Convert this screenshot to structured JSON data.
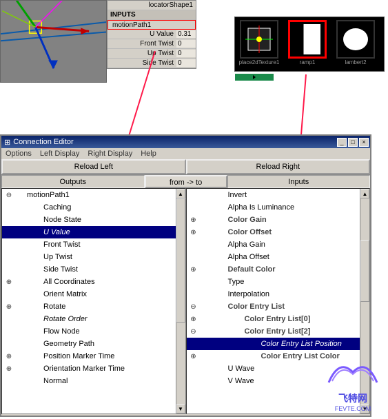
{
  "attr_panel": {
    "shape": "locatorShape1",
    "inputs_header": "INPUTS",
    "node": "motionPath1",
    "rows": [
      {
        "label": "U Value",
        "value": "0.31"
      },
      {
        "label": "Front Twist",
        "value": "0"
      },
      {
        "label": "Up Twist",
        "value": "0"
      },
      {
        "label": "Side Twist",
        "value": "0"
      }
    ]
  },
  "hypershade": {
    "nodes": [
      {
        "name": "place2dTexture1",
        "selected": false,
        "kind": "place2d"
      },
      {
        "name": "ramp1",
        "selected": true,
        "kind": "ramp"
      },
      {
        "name": "lambert2",
        "selected": false,
        "kind": "lambert"
      }
    ]
  },
  "conn_editor": {
    "title": "Connection Editor",
    "menus": [
      "Options",
      "Left Display",
      "Right Display",
      "Help"
    ],
    "reload_left": "Reload Left",
    "reload_right": "Reload Right",
    "outputs_label": "Outputs",
    "fromto_label": "from -> to",
    "inputs_label": "Inputs",
    "left_tree": [
      {
        "exp": "⊖",
        "indent": 0,
        "text": "motionPath1",
        "italic": false,
        "bold": false,
        "sel": false
      },
      {
        "exp": "",
        "indent": 1,
        "text": "Caching",
        "italic": false,
        "bold": false,
        "sel": false
      },
      {
        "exp": "",
        "indent": 1,
        "text": "Node State",
        "italic": false,
        "bold": false,
        "sel": false
      },
      {
        "exp": "",
        "indent": 1,
        "text": "U Value",
        "italic": true,
        "bold": false,
        "sel": true
      },
      {
        "exp": "",
        "indent": 1,
        "text": "Front Twist",
        "italic": false,
        "bold": false,
        "sel": false
      },
      {
        "exp": "",
        "indent": 1,
        "text": "Up Twist",
        "italic": false,
        "bold": false,
        "sel": false
      },
      {
        "exp": "",
        "indent": 1,
        "text": "Side Twist",
        "italic": false,
        "bold": false,
        "sel": false
      },
      {
        "exp": "⊕",
        "indent": 1,
        "text": "All Coordinates",
        "italic": false,
        "bold": false,
        "sel": false
      },
      {
        "exp": "",
        "indent": 1,
        "text": "Orient Matrix",
        "italic": false,
        "bold": false,
        "sel": false
      },
      {
        "exp": "⊕",
        "indent": 1,
        "text": "Rotate",
        "italic": false,
        "bold": false,
        "sel": false
      },
      {
        "exp": "",
        "indent": 1,
        "text": "Rotate Order",
        "italic": true,
        "bold": false,
        "sel": false
      },
      {
        "exp": "",
        "indent": 1,
        "text": "Flow Node",
        "italic": false,
        "bold": false,
        "sel": false
      },
      {
        "exp": "",
        "indent": 1,
        "text": "Geometry Path",
        "italic": false,
        "bold": false,
        "sel": false
      },
      {
        "exp": "⊕",
        "indent": 1,
        "text": "Position Marker Time",
        "italic": false,
        "bold": false,
        "sel": false
      },
      {
        "exp": "⊕",
        "indent": 1,
        "text": "Orientation Marker Time",
        "italic": false,
        "bold": false,
        "sel": false
      },
      {
        "exp": "",
        "indent": 1,
        "text": "Normal",
        "italic": false,
        "bold": false,
        "sel": false
      }
    ],
    "right_tree": [
      {
        "exp": "",
        "indent": 1,
        "text": "Invert",
        "italic": false,
        "bold": false,
        "sel": false
      },
      {
        "exp": "",
        "indent": 1,
        "text": "Alpha Is Luminance",
        "italic": false,
        "bold": false,
        "sel": false
      },
      {
        "exp": "⊕",
        "indent": 1,
        "text": "Color Gain",
        "italic": false,
        "bold": true,
        "sel": false
      },
      {
        "exp": "⊕",
        "indent": 1,
        "text": "Color Offset",
        "italic": false,
        "bold": true,
        "sel": false
      },
      {
        "exp": "",
        "indent": 1,
        "text": "Alpha Gain",
        "italic": false,
        "bold": false,
        "sel": false
      },
      {
        "exp": "",
        "indent": 1,
        "text": "Alpha Offset",
        "italic": false,
        "bold": false,
        "sel": false
      },
      {
        "exp": "⊕",
        "indent": 1,
        "text": "Default Color",
        "italic": false,
        "bold": true,
        "sel": false
      },
      {
        "exp": "",
        "indent": 1,
        "text": "Type",
        "italic": false,
        "bold": false,
        "sel": false
      },
      {
        "exp": "",
        "indent": 1,
        "text": "Interpolation",
        "italic": false,
        "bold": false,
        "sel": false
      },
      {
        "exp": "⊖",
        "indent": 1,
        "text": "Color Entry List",
        "italic": false,
        "bold": true,
        "sel": false
      },
      {
        "exp": "⊕",
        "indent": 2,
        "text": "Color Entry List[0]",
        "italic": false,
        "bold": true,
        "sel": false
      },
      {
        "exp": "⊖",
        "indent": 2,
        "text": "Color Entry List[2]",
        "italic": false,
        "bold": true,
        "sel": false
      },
      {
        "exp": "",
        "indent": 3,
        "text": "Color Entry List Position",
        "italic": true,
        "bold": false,
        "sel": true
      },
      {
        "exp": "⊕",
        "indent": 3,
        "text": "Color Entry List Color",
        "italic": false,
        "bold": true,
        "sel": false
      },
      {
        "exp": "",
        "indent": 1,
        "text": "U Wave",
        "italic": false,
        "bold": false,
        "sel": false
      },
      {
        "exp": "",
        "indent": 1,
        "text": "V Wave",
        "italic": false,
        "bold": false,
        "sel": false
      }
    ]
  },
  "logo": {
    "text": "飞特网",
    "url": "FEVTE.COM"
  }
}
